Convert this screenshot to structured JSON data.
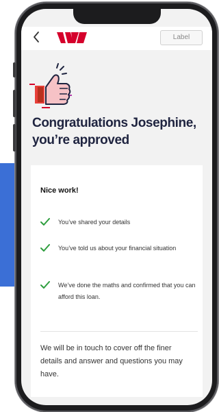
{
  "nav": {
    "back_icon": "chevron-left-icon",
    "logo": "westpac-logo",
    "label_button": "Label",
    "brand_color": "#d5002b"
  },
  "hero": {
    "icon": "thumbs-up-icon"
  },
  "title": "Congratulations Josephine, you’re approved",
  "card": {
    "heading": "Nice work!",
    "check_icon": "check-icon",
    "check_color": "#2e9e3e",
    "items": [
      "You’ve shared your details",
      "You’ve told us about your financial situation",
      "We’ve done the maths and confirmed that you can afford this loan."
    ],
    "footer": "We will be in touch to cover off the finer details and answer and questions you may have."
  }
}
